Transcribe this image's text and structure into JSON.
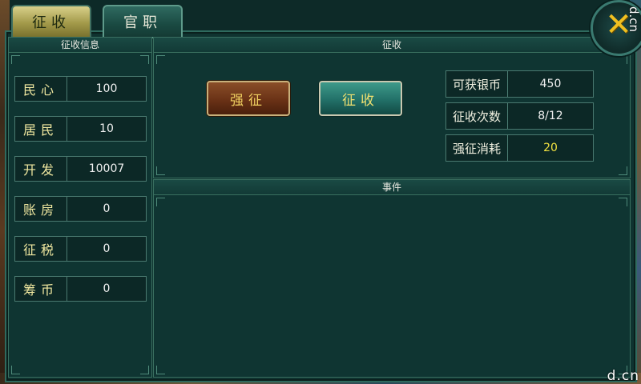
{
  "tabs": [
    {
      "label": "征收",
      "active": true
    },
    {
      "label": "官职",
      "active": false
    }
  ],
  "watermark": {
    "right": "d.cn",
    "bottom": "d.cn"
  },
  "info_panel": {
    "title": "征收信息",
    "rows": [
      {
        "label": "民心",
        "value": "100"
      },
      {
        "label": "居民",
        "value": "10"
      },
      {
        "label": "开发",
        "value": "10007"
      },
      {
        "label": "账房",
        "value": "0"
      },
      {
        "label": "征税",
        "value": "0"
      },
      {
        "label": "筹币",
        "value": "0"
      }
    ]
  },
  "collect_panel": {
    "title": "征收",
    "force_button": "强征",
    "collect_button": "征收",
    "stats": [
      {
        "label": "可获银币",
        "value": "450"
      },
      {
        "label": "征收次数",
        "value": "8/12"
      },
      {
        "label": "强征消耗",
        "value": "20"
      }
    ]
  },
  "events_panel": {
    "title": "事件"
  },
  "colors": {
    "accent": "#f0c020",
    "panel": "#0f3532",
    "border": "#3a7060"
  },
  "icons": {
    "close": "close-icon"
  }
}
